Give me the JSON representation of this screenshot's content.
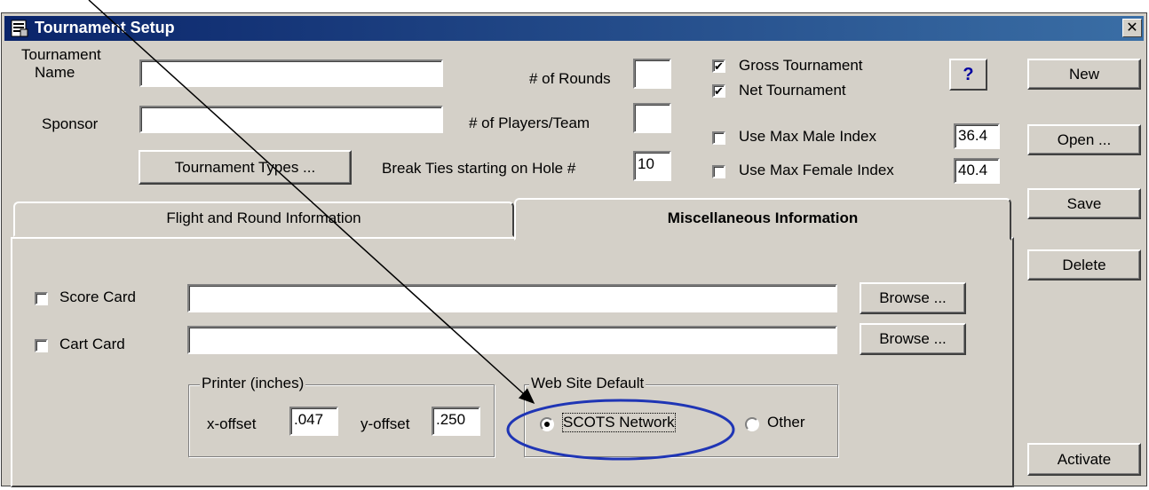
{
  "window": {
    "title": "Tournament Setup",
    "close_glyph": "✕"
  },
  "header_fields": {
    "tournament_name_label_1": "Tournament",
    "tournament_name_label_2": "Name",
    "tournament_name_value": "",
    "sponsor_label": "Sponsor",
    "sponsor_value": "",
    "tournament_types_button": "Tournament Types ...",
    "rounds_label": "# of Rounds",
    "rounds_value": "",
    "players_team_label": "# of Players/Team",
    "players_team_value": "",
    "break_ties_label": "Break Ties starting on Hole #",
    "break_ties_value": "10"
  },
  "options": {
    "gross_label": "Gross Tournament",
    "gross_checked": true,
    "net_label": "Net Tournament",
    "net_checked": true,
    "max_male_label": "Use Max Male Index",
    "max_male_checked": false,
    "max_male_value": "36.4",
    "max_female_label": "Use Max Female Index",
    "max_female_checked": false,
    "max_female_value": "40.4",
    "help_glyph": "?"
  },
  "side_buttons": {
    "new": "New",
    "open": "Open ...",
    "save": "Save",
    "delete": "Delete",
    "activate": "Activate"
  },
  "tabs": [
    {
      "label": "Flight and Round Information",
      "active": false
    },
    {
      "label": "Miscellaneous Information",
      "active": true
    }
  ],
  "misc": {
    "score_card_label": "Score Card",
    "score_card_checked": false,
    "score_card_value": "",
    "cart_card_label": "Cart Card",
    "cart_card_checked": false,
    "cart_card_value": "",
    "browse_label": "Browse ...",
    "printer_group_title": "Printer (inches)",
    "x_offset_label": "x-offset",
    "x_offset_value": ".047",
    "y_offset_label": "y-offset",
    "y_offset_value": ".250",
    "web_group_title": "Web Site Default",
    "scots_label": "SCOTS Network",
    "scots_selected": true,
    "other_label": "Other",
    "other_selected": false
  },
  "annotation_colors": {
    "arrow": "#000000",
    "ellipse": "#1f35b5"
  }
}
